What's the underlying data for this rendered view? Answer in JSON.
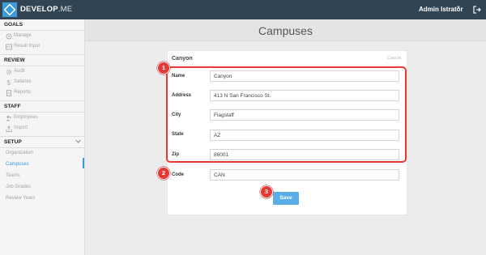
{
  "app": {
    "brand_bold": "DEVELOP",
    "brand_light": ".ME",
    "user_name": "Admin Istrator",
    "logo_icon": "diamond-logo-icon",
    "signout_icon": "sign-out-icon"
  },
  "sidebar": {
    "goals": {
      "title": "GOALS",
      "items": [
        {
          "label": "Manage",
          "icon": "target-icon"
        },
        {
          "label": "Result Input",
          "icon": "table-icon"
        }
      ]
    },
    "review": {
      "title": "REVIEW",
      "items": [
        {
          "label": "Audit",
          "icon": "cogs-icon"
        },
        {
          "label": "Salaries",
          "icon": "dollar-icon"
        },
        {
          "label": "Reports",
          "icon": "document-icon"
        }
      ]
    },
    "staff": {
      "title": "STAFF",
      "items": [
        {
          "label": "Employees",
          "icon": "users-icon"
        },
        {
          "label": "Import",
          "icon": "upload-icon"
        }
      ]
    },
    "setup": {
      "title": "SETUP",
      "items": [
        {
          "label": "Organization"
        },
        {
          "label": "Campuses"
        },
        {
          "label": "Teams"
        },
        {
          "label": "Job Grades"
        },
        {
          "label": "Review Years"
        }
      ]
    },
    "active_item": "Campuses"
  },
  "page": {
    "title": "Campuses"
  },
  "form": {
    "title": "Canyon",
    "cancel": "Cancel",
    "fields": [
      {
        "label": "Name",
        "value": "Canyon"
      },
      {
        "label": "Address",
        "value": "413 N San Francisco St."
      },
      {
        "label": "City",
        "value": "Flagstaff"
      },
      {
        "label": "State",
        "value": "AZ"
      },
      {
        "label": "Zip",
        "value": "86001"
      },
      {
        "label": "Code",
        "value": "CAN"
      }
    ],
    "save": "Save"
  },
  "annotations": [
    "1",
    "2",
    "3"
  ],
  "colors": {
    "topbar": "#314453",
    "accent": "#3d9ad8",
    "save_button": "#5aaee8",
    "highlight": "#e53935"
  }
}
